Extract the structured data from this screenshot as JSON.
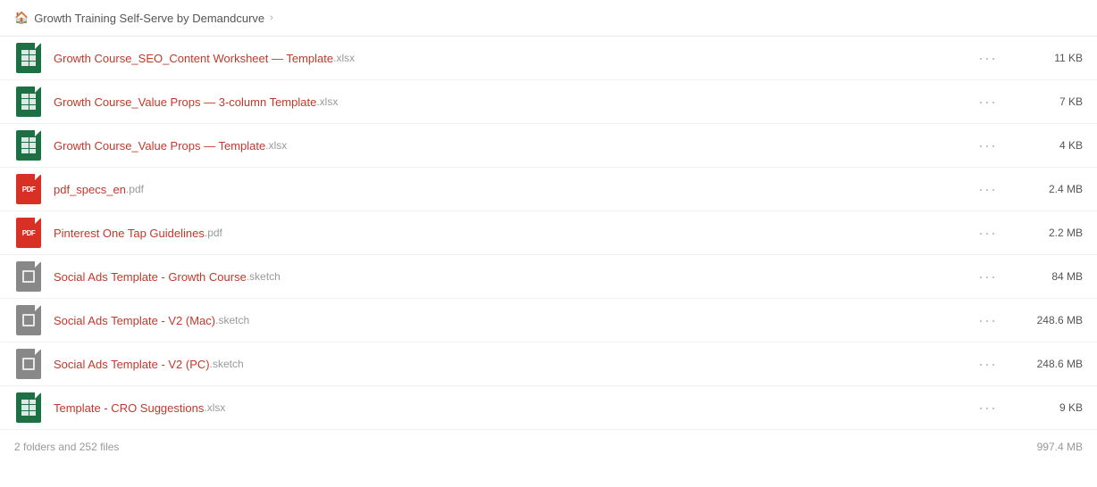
{
  "breadcrumb": {
    "home_label": "Growth Training Self-Serve by Demandcurve",
    "chevron": "›"
  },
  "files": [
    {
      "id": 1,
      "type": "xlsx",
      "name": "Growth Course_SEO_Content Worksheet — Template",
      "ext": ".xlsx",
      "size": "11 KB"
    },
    {
      "id": 2,
      "type": "xlsx",
      "name": "Growth Course_Value Props — 3-column Template",
      "ext": ".xlsx",
      "size": "7 KB"
    },
    {
      "id": 3,
      "type": "xlsx",
      "name": "Growth Course_Value Props — Template",
      "ext": ".xlsx",
      "size": "4 KB"
    },
    {
      "id": 4,
      "type": "pdf",
      "name": "pdf_specs_en",
      "ext": ".pdf",
      "size": "2.4 MB"
    },
    {
      "id": 5,
      "type": "pdf",
      "name": "Pinterest One Tap Guidelines",
      "ext": ".pdf",
      "size": "2.2 MB"
    },
    {
      "id": 6,
      "type": "sketch",
      "name": "Social Ads Template - Growth Course",
      "ext": ".sketch",
      "size": "84 MB"
    },
    {
      "id": 7,
      "type": "sketch",
      "name": "Social Ads Template - V2 (Mac)",
      "ext": ".sketch",
      "size": "248.6 MB"
    },
    {
      "id": 8,
      "type": "sketch",
      "name": "Social Ads Template - V2 (PC)",
      "ext": ".sketch",
      "size": "248.6 MB"
    },
    {
      "id": 9,
      "type": "xlsx",
      "name": "Template - CRO Suggestions",
      "ext": ".xlsx",
      "size": "9 KB"
    }
  ],
  "footer": {
    "summary": "2 folders and 252 files",
    "total_size": "997.4 MB"
  },
  "labels": {
    "dots": "···"
  }
}
